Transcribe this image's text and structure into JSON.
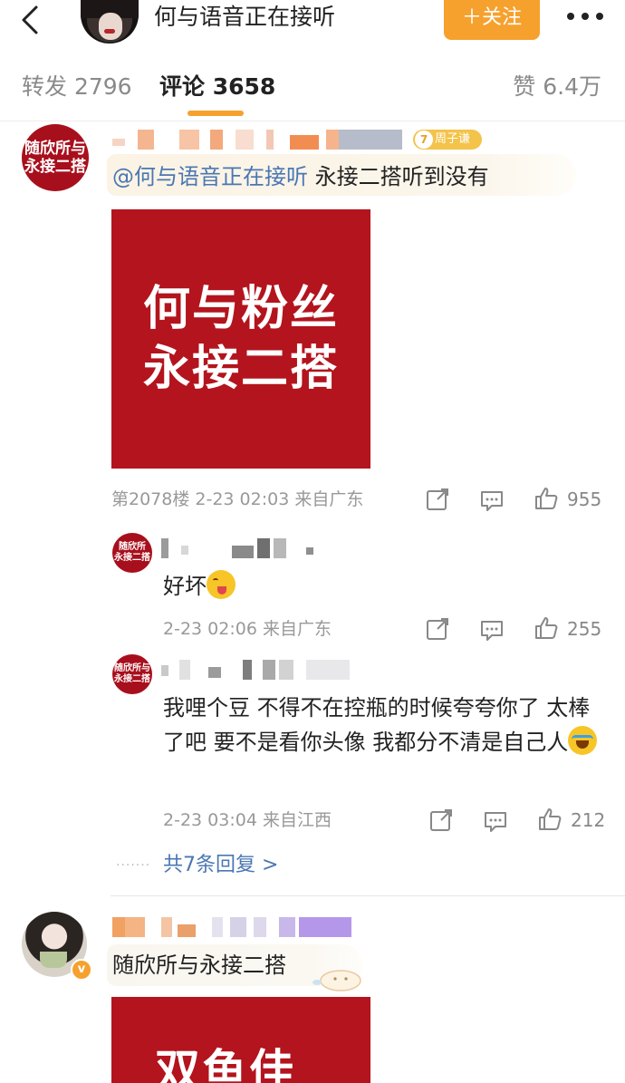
{
  "header": {
    "name": "何与语音正在接听",
    "follow_label": "＋关注"
  },
  "tabs": {
    "repost": "转发 2796",
    "comments": "评论 3658",
    "likes": "赞 6.4万"
  },
  "colors": {
    "accent": "#f6a12e",
    "link": "#4a77b3",
    "card_red": "#b3141d"
  },
  "comment1": {
    "avatar_lines": [
      "随欣所与",
      "永接二搭"
    ],
    "badge_level": "7",
    "badge_text": "周子谦",
    "mention": "@何与语音正在接听",
    "text": " 永接二搭听到没有",
    "card_lines": [
      "何与粉丝",
      "永接二搭"
    ],
    "meta": "第2078楼  2-23 02:03  来自广东",
    "likes": "955",
    "icons": [
      "share-icon",
      "comment-icon",
      "like-icon"
    ]
  },
  "reply1": {
    "avatar_lines": [
      "随欣所",
      "永接二搭"
    ],
    "text": "好坏",
    "emoji": "tongue-emoji",
    "meta": "2-23 02:06  来自广东",
    "likes": "255"
  },
  "reply2": {
    "avatar_lines": [
      "随欣所与",
      "永接二搭"
    ],
    "text": "我哩个豆 不得不在控瓶的时候夸夸你了 太棒了吧 要不是看你头像 我都分不清是自己人",
    "emoji": "laugh-cry-emoji",
    "meta": "2-23 03:04  来自江西",
    "likes": "212"
  },
  "more_replies": {
    "dots": "·······",
    "label": "共7条回复 >"
  },
  "comment2": {
    "v_badge": "v",
    "text": "随欣所与永接二搭",
    "card_partial": "双鱼佳"
  }
}
